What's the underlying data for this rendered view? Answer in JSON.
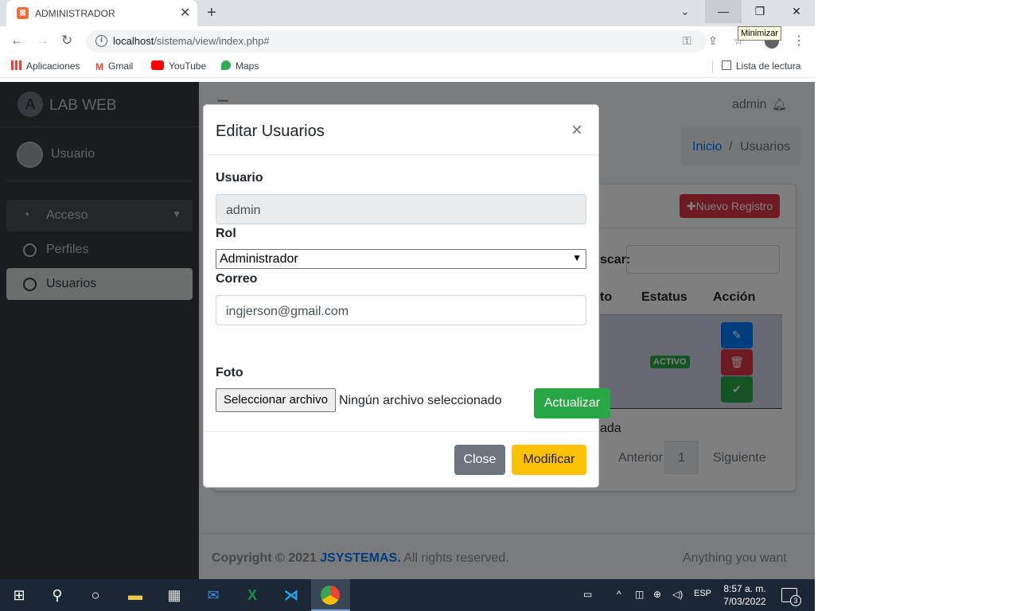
{
  "browser": {
    "tab_title": "ADMINISTRADOR",
    "url_host": "localhost",
    "url_path": "/sistema/view/index.php#",
    "tooltip": "Minimizar",
    "bookmarks": [
      "Aplicaciones",
      "Gmail",
      "YouTube",
      "Maps"
    ],
    "reading_list": "Lista de lectura"
  },
  "sidebar": {
    "brand": "LAB WEB",
    "brand_logo": "A",
    "user": "Usuario",
    "items": [
      {
        "label": "Acceso"
      },
      {
        "label": "Perfiles"
      },
      {
        "label": "Usuarios"
      }
    ]
  },
  "topbar": {
    "user": "admin"
  },
  "breadcrumb": {
    "home": "Inicio",
    "separator": "/",
    "current": "Usuarios"
  },
  "card": {
    "new_button": "Nuevo Registro",
    "search_label_partial": "scar:",
    "columns_visible": [
      "to",
      "Estatus",
      "Acción"
    ],
    "status_badge": "ACTIVO",
    "info_partial": "ada",
    "pagination": {
      "prev": "Anterior",
      "page": "1",
      "next": "Siguiente"
    }
  },
  "footer": {
    "copyright_prefix": "Copyright © 2021",
    "company": "JSYSTEMAS.",
    "rights": "All rights reserved.",
    "right_text": "Anything you want"
  },
  "modal": {
    "title": "Editar Usuarios",
    "close_symbol": "×",
    "usuario_label": "Usuario",
    "usuario_value": "admin",
    "rol_label": "Rol",
    "rol_selected": "Administrador",
    "correo_label": "Correo",
    "correo_value": "ingjerson@gmail.com",
    "foto_label": "Foto",
    "file_button": "Seleccionar archivo",
    "file_status": "Ningún archivo seleccionado",
    "update_button": "Actualizar",
    "close_button": "Close",
    "modify_button": "Modificar"
  },
  "taskbar": {
    "language": "ESP",
    "time": "8:57 a. m.",
    "date": "7/03/2022",
    "notifications": "3"
  },
  "colors": {
    "sidebar": "#343a40",
    "primary": "#007bff",
    "danger": "#dc3545",
    "success": "#28a745",
    "warning": "#ffc107",
    "secondary": "#6c757d"
  }
}
